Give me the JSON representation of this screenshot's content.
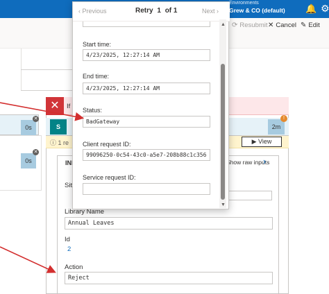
{
  "header": {
    "environment_label": "Environments",
    "environment_name": "Grew & CO (default)",
    "bell_icon": "bell-icon",
    "gear_icon": "gear-icon"
  },
  "toolbar": {
    "resubmit_label": "Resubmit",
    "cancel_label": "Cancel",
    "edit_label": "Edit"
  },
  "canvas": {
    "left_durations": [
      "0s",
      "0s"
    ],
    "banner_text": "If",
    "action_duration": "2m",
    "retry_info_text": "1 re",
    "view_button_label": "View",
    "inputs_header": "INP",
    "show_raw_inputs_label": "Show raw inputs",
    "site_label_truncated": "Sit",
    "fields": [
      {
        "label": "Library Name",
        "value": "Annual Leaves"
      },
      {
        "label": "Id",
        "value": "2"
      },
      {
        "label": "Action",
        "value": "Reject"
      }
    ]
  },
  "popup": {
    "previous_label": "Previous",
    "title_prefix": "Retry",
    "current_index": "1",
    "of_total": "of 1",
    "next_label": "Next",
    "fields": [
      {
        "label": "Start time:",
        "value": "4/23/2025, 12:27:14 AM"
      },
      {
        "label": "End time:",
        "value": "4/23/2025, 12:27:14 AM"
      },
      {
        "label": "Status:",
        "value": "BadGateway"
      },
      {
        "label": "Client request ID:",
        "value": "99096250-0c54-43c0-a5e7-208b88c1c356"
      },
      {
        "label": "Service request ID:",
        "value": ""
      }
    ]
  },
  "colors": {
    "brand": "#0f6cbd",
    "error": "#d13438",
    "arrow": "#d32f2f"
  }
}
